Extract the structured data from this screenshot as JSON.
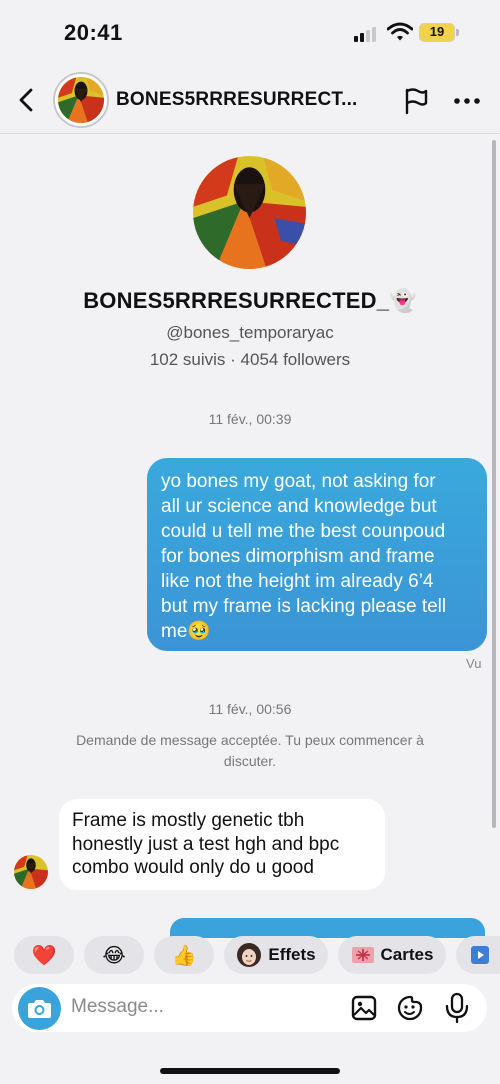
{
  "status_bar": {
    "time": "20:41",
    "battery": "19"
  },
  "header": {
    "name": "BONES5RRRESURRECT..."
  },
  "profile": {
    "name": "BONES5RRRESURRECTED_👻",
    "handle": "@bones_temporaryac",
    "stats": "102 suivis · 4054 followers"
  },
  "messages": {
    "timestamp_1": "11 fév., 00:39",
    "outgoing_1": {
      "line_1": "yo bones my goat, not asking for",
      "line_2": "all ur science and knowledge but",
      "line_3": "could u tell me the best counpoud",
      "line_4": "for bones dimorphism and frame",
      "line_5": "like not the height im already 6’4",
      "line_6": "but my frame is lacking please tell",
      "line_7": "me🥹"
    },
    "seen_label": "Vu",
    "timestamp_2": "11 fév., 00:56",
    "system_line_1": "Demande de message acceptée. Tu peux commencer à",
    "system_line_2": "discuter.",
    "incoming_1": {
      "line_1": "Frame is mostly genetic tbh",
      "line_2": "honestly just a test hgh and bpc",
      "line_3": "combo would only do u good"
    }
  },
  "quick_replies": [
    {
      "label": "❤️"
    },
    {
      "label": "😂"
    },
    {
      "label": "👍"
    },
    {
      "label": "Effets"
    },
    {
      "label": "Cartes"
    }
  ],
  "composer": {
    "placeholder": "Message..."
  },
  "colors": {
    "accent": "#3ba3dc",
    "background": "#f2f2f5",
    "battery": "#f2d24b"
  },
  "icons": {
    "back": "chevron-left-icon",
    "flag": "flag-icon",
    "more": "more-horizontal-icon",
    "camera": "camera-icon",
    "gallery": "image-icon",
    "sticker": "sticker-icon",
    "mic": "microphone-icon"
  }
}
